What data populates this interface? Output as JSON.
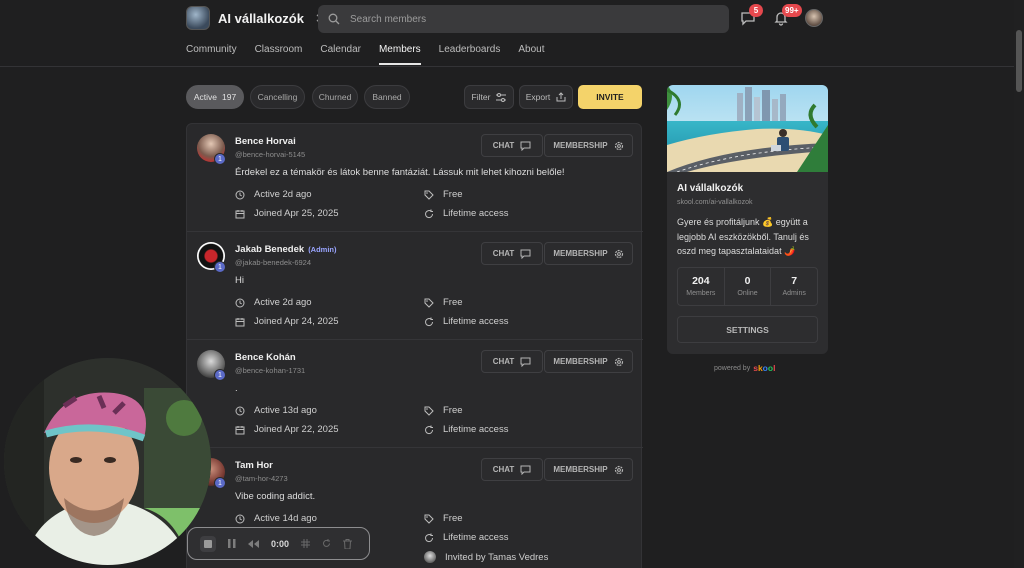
{
  "header": {
    "community_name": "AI vállalkozók",
    "search_placeholder": "Search members",
    "chat_badge": "5",
    "notif_badge": "99+"
  },
  "nav": [
    "Community",
    "Classroom",
    "Calendar",
    "Members",
    "Leaderboards",
    "About"
  ],
  "nav_active": "Members",
  "filters": {
    "active_label": "Active",
    "active_count": "197",
    "cancelling": "Cancelling",
    "churned": "Churned",
    "banned": "Banned",
    "filter": "Filter",
    "export": "Export",
    "invite": "INVITE"
  },
  "buttons": {
    "chat": "CHAT",
    "membership": "MEMBERSHIP"
  },
  "members": [
    {
      "name": "Bence Horvai",
      "admin": "",
      "handle": "@bence-horvai-5145",
      "bio": "Érdekel ez a témakör és látok benne fantáziát. Lássuk mit lehet kihozni belőle!",
      "level": "1",
      "active": "Active 2d ago",
      "joined": "Joined Apr 25, 2025",
      "price": "Free",
      "access": "Lifetime access",
      "invited": ""
    },
    {
      "name": "Jakab Benedek",
      "admin": "(Admin)",
      "handle": "@jakab-benedek-6924",
      "bio": "Hi",
      "level": "1",
      "active": "Active 2d ago",
      "joined": "Joined Apr 24, 2025",
      "price": "Free",
      "access": "Lifetime access",
      "invited": ""
    },
    {
      "name": "Bence Kohán",
      "admin": "",
      "handle": "@bence-kohan-1731",
      "bio": ".",
      "level": "1",
      "active": "Active 13d ago",
      "joined": "Joined Apr 22, 2025",
      "price": "Free",
      "access": "Lifetime access",
      "invited": ""
    },
    {
      "name": "Tam Hor",
      "admin": "",
      "handle": "@tam-hor-4273",
      "bio": "Vibe coding addict.",
      "level": "1",
      "active": "Active 14d ago",
      "joined": "",
      "price": "Free",
      "access": "Lifetime access",
      "invited": "Invited by Tamas Vedres"
    }
  ],
  "card": {
    "title": "AI vállalkozók",
    "url": "skool.com/ai-vallalkozok",
    "description": "Gyere és profitáljunk 💰 együtt a legjobb AI eszközökből. Tanulj és oszd meg tapasztalataidat 🌶️",
    "stats": [
      {
        "value": "204",
        "label": "Members"
      },
      {
        "value": "0",
        "label": "Online"
      },
      {
        "value": "7",
        "label": "Admins"
      }
    ],
    "settings": "SETTINGS",
    "powered_by": "powered by"
  },
  "skool_letters": [
    "s",
    "k",
    "o",
    "o",
    "l"
  ],
  "skool_colors": [
    "#e5484d",
    "#f59e0b",
    "#3b82f6",
    "#22c55e",
    "#e5484d"
  ],
  "recorder": {
    "time": "0:00"
  },
  "colors": {
    "accent": "#f4d36a",
    "badge": "#e5484d",
    "level": "#5b6ac7",
    "admin": "#9aa5ff"
  }
}
